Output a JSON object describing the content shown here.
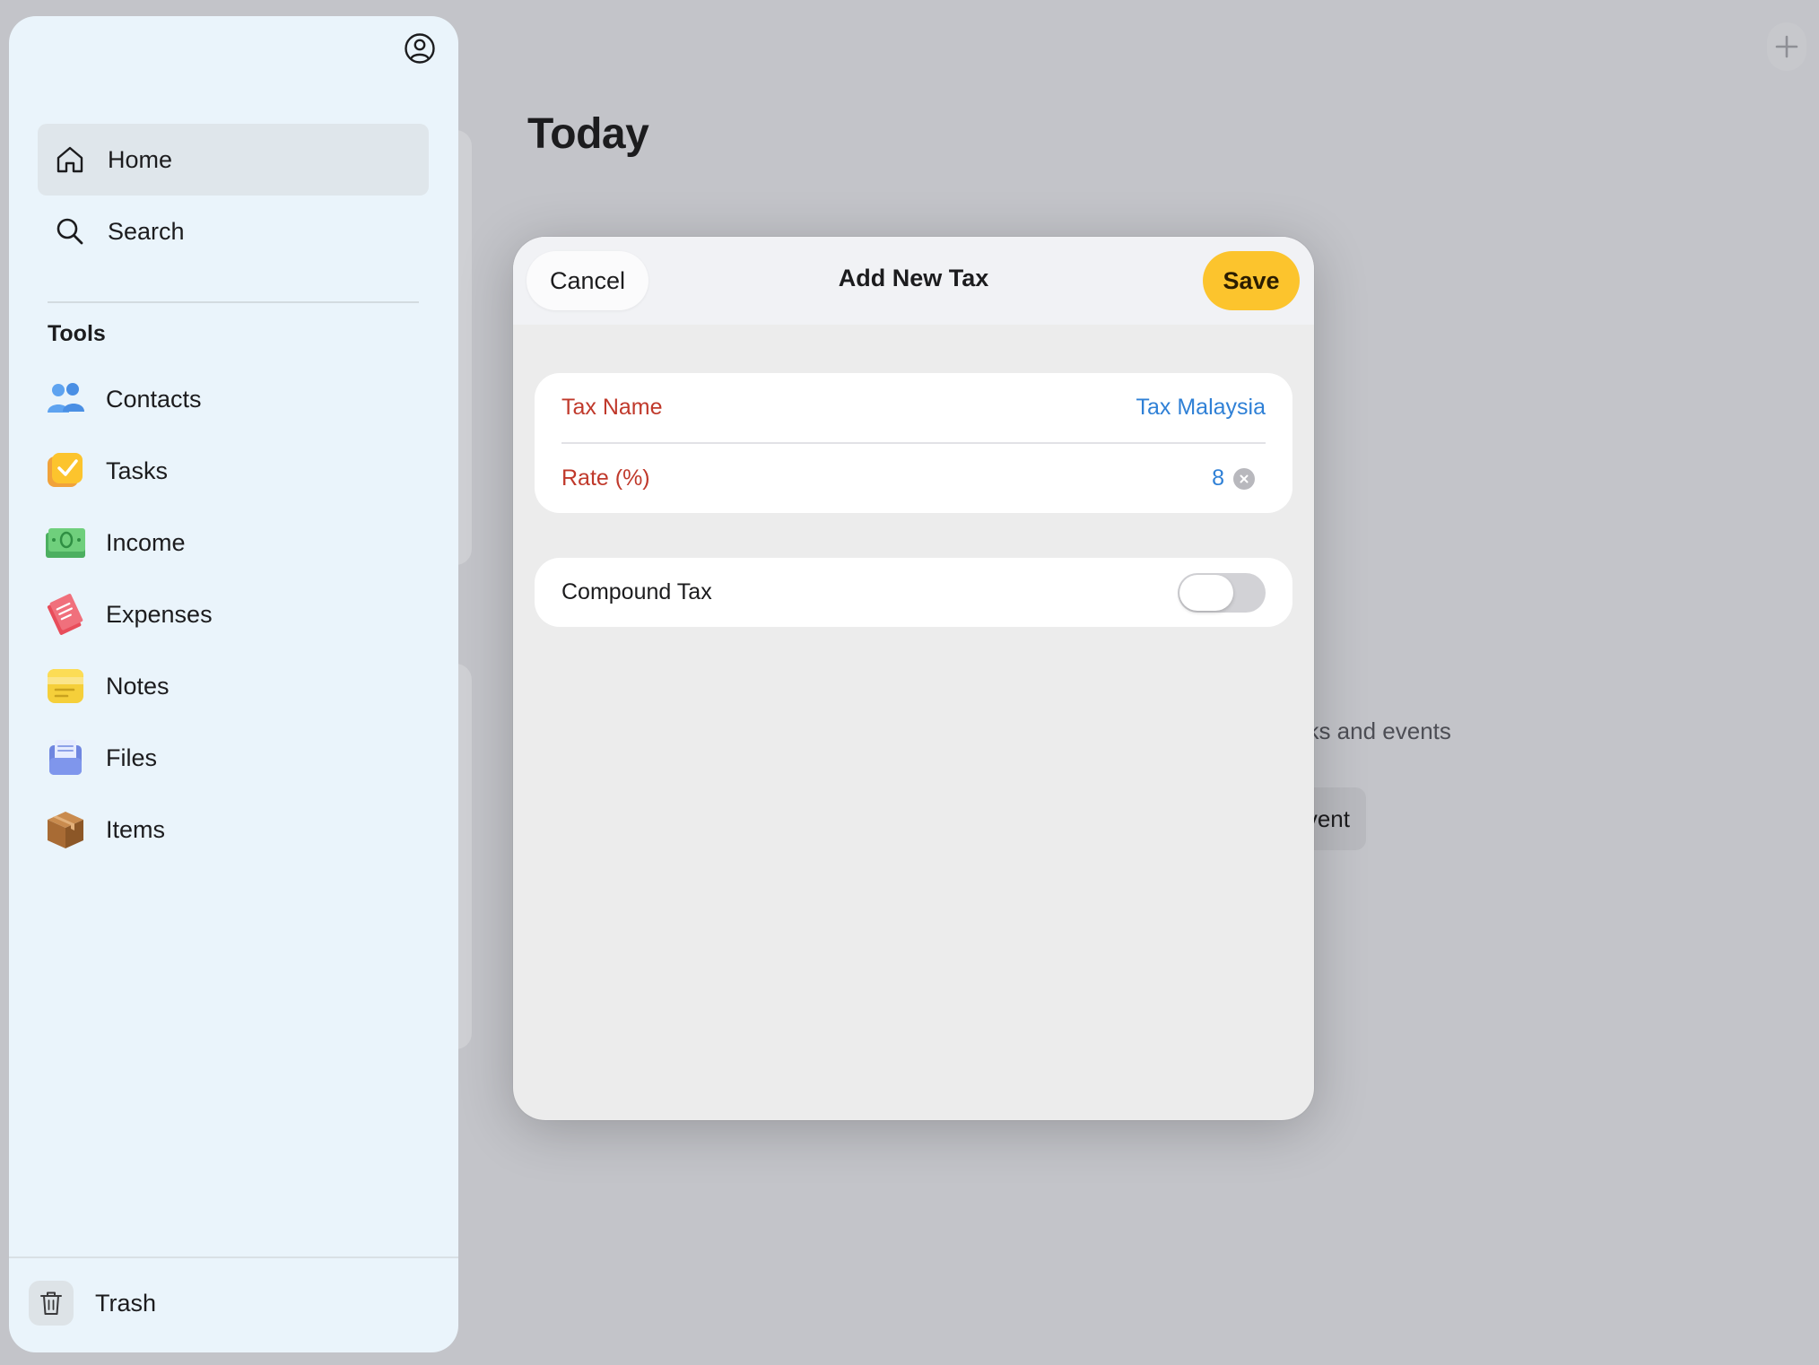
{
  "background": {
    "title": "Today",
    "empty_text": "asks and events",
    "empty_button_label": "vent"
  },
  "sidebar": {
    "nav": [
      {
        "label": "Home",
        "icon": "home-icon",
        "active": true
      },
      {
        "label": "Search",
        "icon": "search-icon",
        "active": false
      }
    ],
    "tools_title": "Tools",
    "tools": [
      {
        "label": "Contacts",
        "icon": "contacts-icon"
      },
      {
        "label": "Tasks",
        "icon": "tasks-icon"
      },
      {
        "label": "Income",
        "icon": "income-icon"
      },
      {
        "label": "Expenses",
        "icon": "expenses-icon"
      },
      {
        "label": "Notes",
        "icon": "notes-icon"
      },
      {
        "label": "Files",
        "icon": "files-icon"
      },
      {
        "label": "Items",
        "icon": "items-icon"
      }
    ],
    "trash_label": "Trash"
  },
  "modal": {
    "title": "Add New Tax",
    "cancel_label": "Cancel",
    "save_label": "Save",
    "fields": {
      "tax_name_label": "Tax Name",
      "tax_name_value": "Tax Malaysia",
      "rate_label": "Rate (%)",
      "rate_value": "8"
    },
    "compound_label": "Compound Tax",
    "compound_enabled": false
  },
  "colors": {
    "accent": "#fcc42d",
    "field_label": "#c0392b",
    "field_value": "#2f80d6"
  }
}
